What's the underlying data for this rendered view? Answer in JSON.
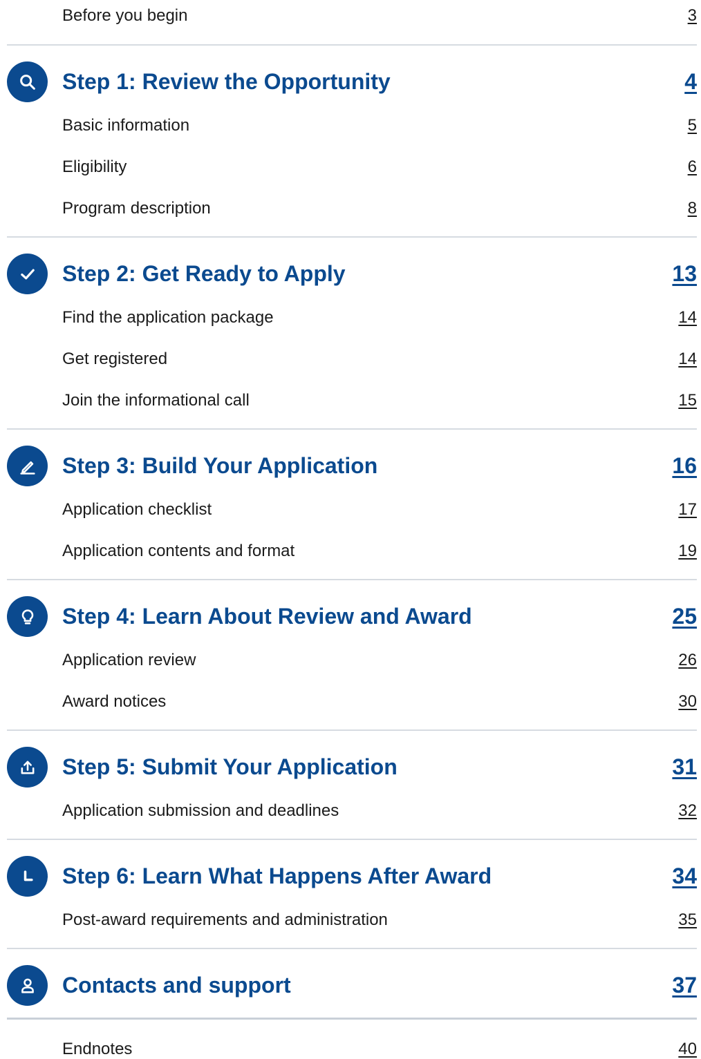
{
  "toc": {
    "before": {
      "label": "Before you begin",
      "page": "3"
    },
    "step1": {
      "label": "Step 1: Review the Opportunity",
      "page": "4",
      "icon": "search-icon"
    },
    "step1_items": [
      {
        "label": "Basic information",
        "page": "5"
      },
      {
        "label": "Eligibility",
        "page": "6"
      },
      {
        "label": "Program description",
        "page": "8"
      }
    ],
    "step2": {
      "label": "Step 2: Get Ready to Apply",
      "page": "13",
      "icon": "check-icon"
    },
    "step2_items": [
      {
        "label": "Find the application package",
        "page": "14"
      },
      {
        "label": "Get registered",
        "page": "14"
      },
      {
        "label": "Join the informational call",
        "page": "15"
      }
    ],
    "step3": {
      "label": "Step 3: Build Your Application",
      "page": "16",
      "icon": "pencil-icon"
    },
    "step3_items": [
      {
        "label": "Application checklist",
        "page": "17"
      },
      {
        "label": "Application contents and format",
        "page": "19"
      }
    ],
    "step4": {
      "label": "Step 4: Learn About Review and Award",
      "page": "25",
      "icon": "lightbulb-icon"
    },
    "step4_items": [
      {
        "label": "Application review",
        "page": "26"
      },
      {
        "label": "Award notices",
        "page": "30"
      }
    ],
    "step5": {
      "label": "Step 5: Submit Your Application",
      "page": "31",
      "icon": "upload-icon"
    },
    "step5_items": [
      {
        "label": "Application submission and deadlines",
        "page": "32"
      }
    ],
    "step6": {
      "label": "Step 6: Learn What Happens After Award",
      "page": "34",
      "icon": "clock-icon"
    },
    "step6_items": [
      {
        "label": "Post-award requirements and administration",
        "page": "35"
      }
    ],
    "contacts": {
      "label": "Contacts and support",
      "page": "37",
      "icon": "person-icon"
    },
    "endnotes": {
      "label": "Endnotes",
      "page": "40"
    }
  },
  "colors": {
    "accent": "#0b4a8f",
    "divider": "#d6dbe1",
    "text": "#1b1b1b"
  }
}
